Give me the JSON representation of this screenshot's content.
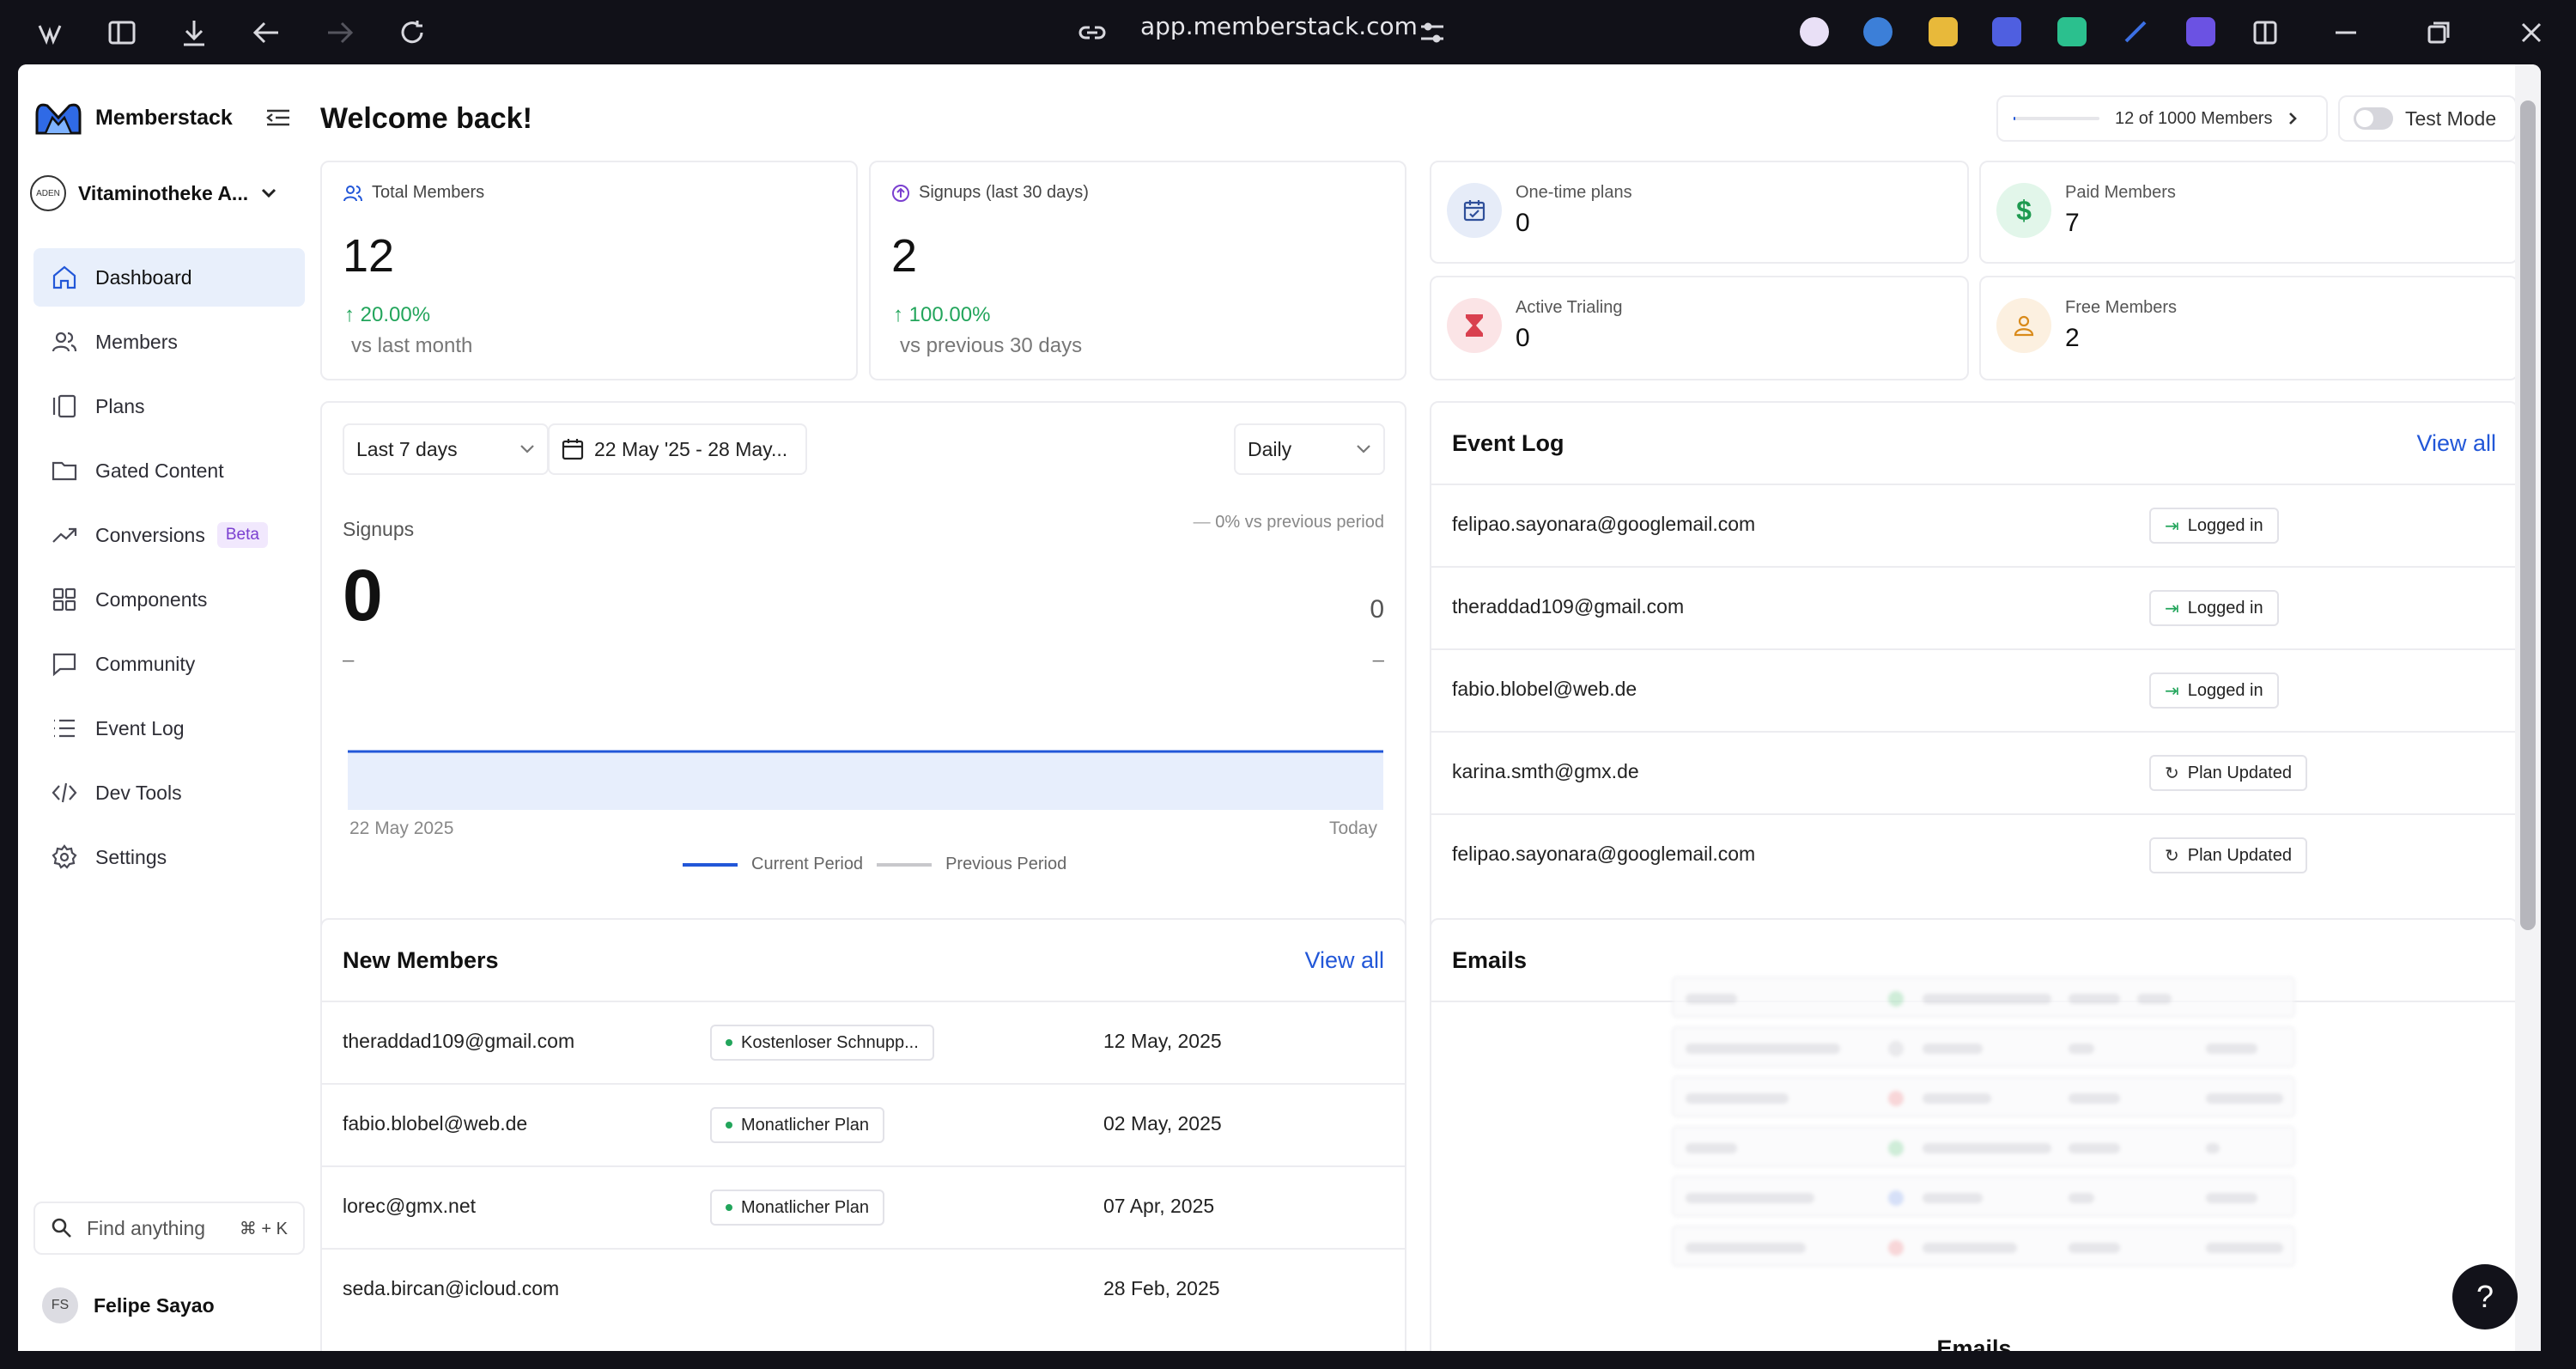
{
  "browser": {
    "url": "app.memberstack.com"
  },
  "sidebar": {
    "brand": "Memberstack",
    "workspace": "Vitaminotheke A...",
    "workspace_avatar_text": "ADEN",
    "items": [
      {
        "label": "Dashboard",
        "icon": "home-icon"
      },
      {
        "label": "Members",
        "icon": "users-icon"
      },
      {
        "label": "Plans",
        "icon": "plans-icon"
      },
      {
        "label": "Gated Content",
        "icon": "folder-icon"
      },
      {
        "label": "Conversions",
        "icon": "trend-icon",
        "badge": "Beta"
      },
      {
        "label": "Components",
        "icon": "grid-icon"
      },
      {
        "label": "Community",
        "icon": "chat-icon"
      },
      {
        "label": "Event Log",
        "icon": "list-icon"
      },
      {
        "label": "Dev Tools",
        "icon": "code-icon"
      },
      {
        "label": "Settings",
        "icon": "gear-icon"
      }
    ],
    "search_placeholder": "Find anything",
    "search_shortcut": "⌘ + K",
    "user": {
      "initials": "FS",
      "name": "Felipe Sayao"
    }
  },
  "header": {
    "title": "Welcome back!",
    "members_usage": "12 of 1000 Members",
    "members_usage_fraction": 0.012,
    "test_mode_label": "Test Mode"
  },
  "stats": {
    "total": {
      "label": "Total Members",
      "value": "12",
      "change": "20.00%",
      "sub": "vs last month"
    },
    "signups": {
      "label": "Signups (last 30 days)",
      "value": "2",
      "change": "100.00%",
      "sub": "vs previous 30 days"
    },
    "one_time": {
      "label": "One-time plans",
      "value": "0"
    },
    "paid": {
      "label": "Paid Members",
      "value": "7"
    },
    "trialing": {
      "label": "Active Trialing",
      "value": "0"
    },
    "free": {
      "label": "Free Members",
      "value": "2"
    }
  },
  "chart_panel": {
    "range": "Last 7 days",
    "dates": "22 May '25 - 28 May...",
    "interval": "Daily",
    "metric_label": "Signups",
    "metric_value": "0",
    "compare_pct": "0%",
    "compare_label": "vs previous period",
    "previous_value": "0",
    "dash_left": "–",
    "dash_right": "–",
    "x_start": "22 May 2025",
    "x_end": "Today",
    "legend_current": "Current Period",
    "legend_previous": "Previous Period",
    "current_color": "#2257d8",
    "previous_color": "#c8c8cc"
  },
  "chart_data": {
    "type": "area",
    "x": [
      "22 May 2025",
      "Today"
    ],
    "series": [
      {
        "name": "Current Period",
        "values": [
          0,
          0
        ]
      },
      {
        "name": "Previous Period",
        "values": [
          0,
          0
        ]
      }
    ]
  },
  "event_log": {
    "title": "Event Log",
    "view_all": "View all",
    "rows": [
      {
        "email": "felipao.sayonara@googlemail.com",
        "event": "Logged in"
      },
      {
        "email": "theraddad109@gmail.com",
        "event": "Logged in"
      },
      {
        "email": "fabio.blobel@web.de",
        "event": "Logged in"
      },
      {
        "email": "karina.smth@gmx.de",
        "event": "Plan Updated"
      },
      {
        "email": "felipao.sayonara@googlemail.com",
        "event": "Plan Updated"
      }
    ]
  },
  "new_members": {
    "title": "New Members",
    "view_all": "View all",
    "rows": [
      {
        "email": "theraddad109@gmail.com",
        "plan": "Kostenloser Schnupp...",
        "date": "12 May, 2025"
      },
      {
        "email": "fabio.blobel@web.de",
        "plan": "Monatlicher Plan",
        "date": "02 May, 2025"
      },
      {
        "email": "lorec@gmx.net",
        "plan": "Monatlicher Plan",
        "date": "07 Apr, 2025"
      },
      {
        "email": "seda.bircan@icloud.com",
        "plan": "",
        "date": "28 Feb, 2025"
      }
    ]
  },
  "emails": {
    "title": "Emails",
    "caption": "Emails"
  },
  "help_label": "?"
}
